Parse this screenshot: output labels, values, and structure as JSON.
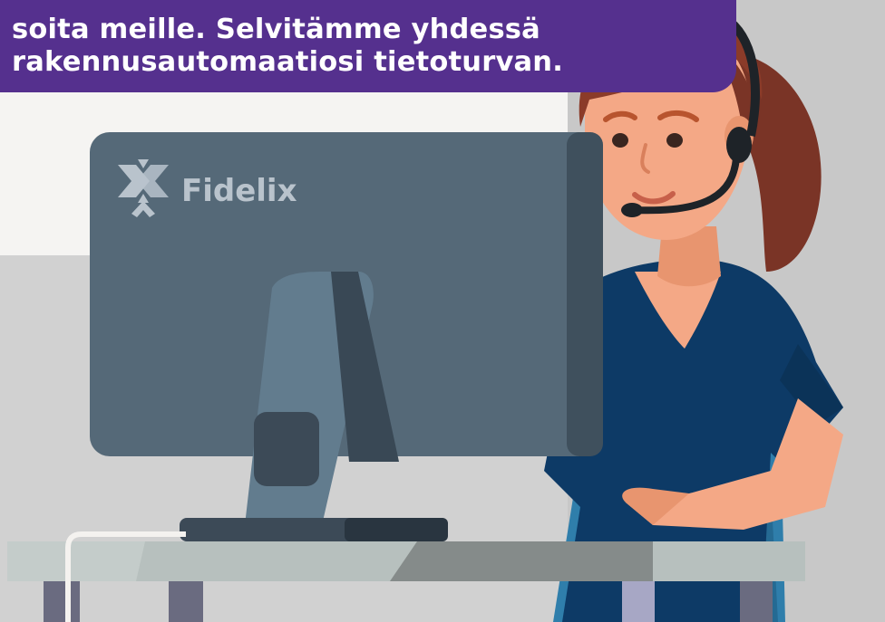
{
  "banner": {
    "line1": "soita meille. Selvitämme yhdessä",
    "line2": "rakennusautomaatiosi tietoturvan."
  },
  "brand": {
    "name": "Fidelix"
  },
  "colors": {
    "banner": "#55308e",
    "wall_back": "#f5f4f2",
    "wall_side": "#cfcfcf",
    "monitor": "#546878",
    "desk": "#b7c0be",
    "shirt": "#0d3a66",
    "chair": "#2e7ba6",
    "skin": "#f4a886",
    "hair": "#8b3b29"
  }
}
